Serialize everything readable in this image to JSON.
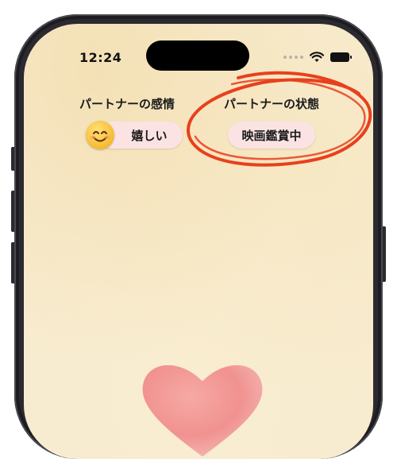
{
  "status_bar": {
    "time": "12:24"
  },
  "partner_emotion": {
    "label": "パートナーの感情",
    "value": "嬉しい",
    "icon": "smiling-face-icon"
  },
  "partner_state": {
    "label": "パートナーの状態",
    "value": "映画鑑賞中"
  },
  "colors": {
    "background": "#f8ecd0",
    "pill": "#fbe3e3",
    "annotation_circle": "#e8401c",
    "heart": "#f08a8a"
  }
}
